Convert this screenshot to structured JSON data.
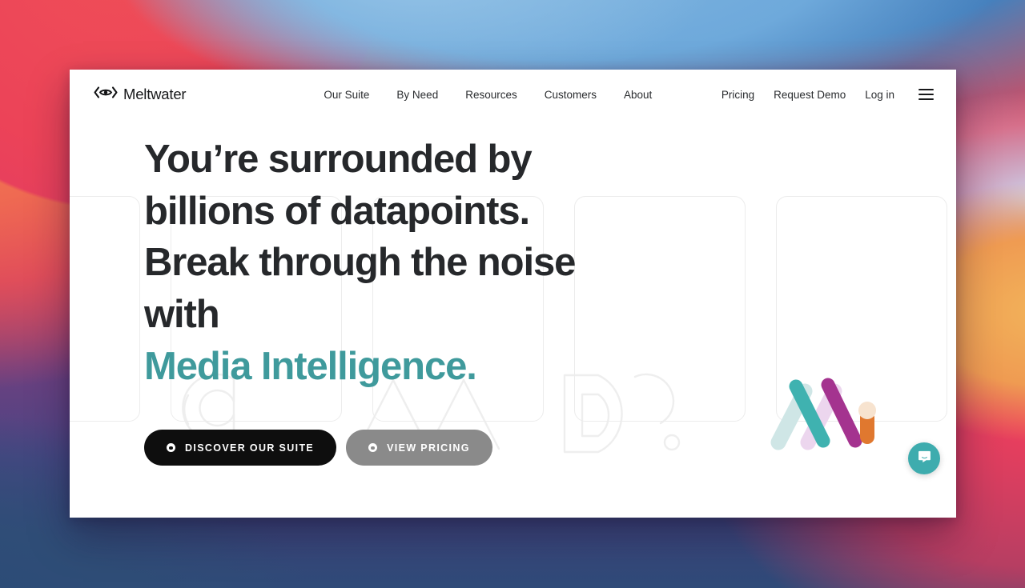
{
  "window": {
    "site_brand": "Meltwater",
    "logo_icon": "meltwater-eye-logo"
  },
  "nav": {
    "main_items": [
      {
        "label": "Our Suite"
      },
      {
        "label": "By Need"
      },
      {
        "label": "Resources"
      },
      {
        "label": "Customers"
      },
      {
        "label": "About"
      }
    ],
    "right_items": [
      {
        "label": "Pricing"
      },
      {
        "label": "Request Demo"
      },
      {
        "label": "Log in"
      }
    ],
    "menu_icon": "hamburger-menu-icon"
  },
  "hero": {
    "headline_line1": "You’re surrounded by",
    "headline_line2": "billions of datapoints.",
    "headline_line3": "Break through the noise with",
    "headline_accent": "Media Intelligence.",
    "accent_color": "#3f9a9c",
    "buttons": {
      "primary": {
        "label": "DISCOVER OUR SUITE",
        "color": "#0e0e0e",
        "icon": "dot-circle-icon"
      },
      "secondary": {
        "label": "VIEW PRICING",
        "color": "#8a8a8a",
        "icon": "dot-circle-icon"
      }
    },
    "illustration": {
      "name": "mi-logo-illustration",
      "colors": [
        "#cfe6e6",
        "#3fb2b0",
        "#e9d3ea",
        "#a4338f",
        "#e0782f",
        "#f7e3cf"
      ]
    },
    "card_count": 5
  },
  "chat": {
    "icon": "chat-bubble-icon",
    "color": "#3eacae"
  }
}
